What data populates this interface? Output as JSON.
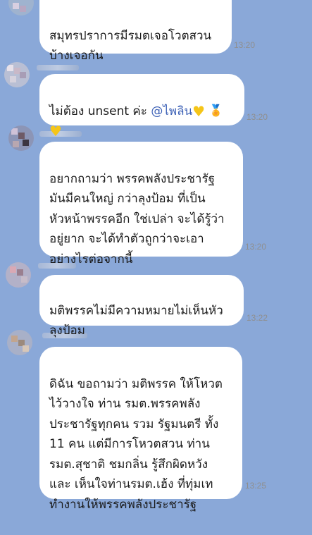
{
  "messages": [
    {
      "text": "สมุทรปราการมีรมตเจอโวตสวน\nบ้างเจอกัน",
      "time": "13:20"
    },
    {
      "text_before": "ไม่ต้อง unsent ค่ะ ",
      "mention": "@ไพลิน",
      "time": "13:20"
    },
    {
      "text": "อยากถามว่า พรรคพลังประชารัฐ\nมันมีคนใหญ่ กว่าลุงป้อม ที่เป็น\nหัวหน้าพรรคอีก ใช่เปล่า จะได้รู้ว่า\nอยู่ยาก จะได้ทำตัวถูกว่าจะเอา\nอย่างไรต่อจากนี้",
      "time": "13:20"
    },
    {
      "text": "มติพรรคไม่มีความหมายไม่เห็นหัว\nลุงป้อม",
      "time": "13:22"
    },
    {
      "text": "ดิฉัน ขอถามว่า มติพรรค ให้โหวต\nไว้วางใจ ท่าน รมต.พรรคพลัง\nประชารัฐทุกคน รวม รัฐมนตรี ทั้ง\n11 คน แต่มีการโหวตสวน ท่าน\nรมต.สุชาติ ชมกลิ่น รู้สึกผิดหวัง\nและ เห็นใจท่านรมต.เฮ้ง ที่ทุ่มเท\nทำงานให้พรรคพลังประชารัฐ",
      "time": "13:25"
    }
  ],
  "colors": {
    "background": "#8aa8d8",
    "bubble": "#ffffff",
    "mention": "#3f63b7",
    "time": "#8f8f8f"
  },
  "icons": [
    "yellow-heart-icon",
    "medal-icon"
  ]
}
